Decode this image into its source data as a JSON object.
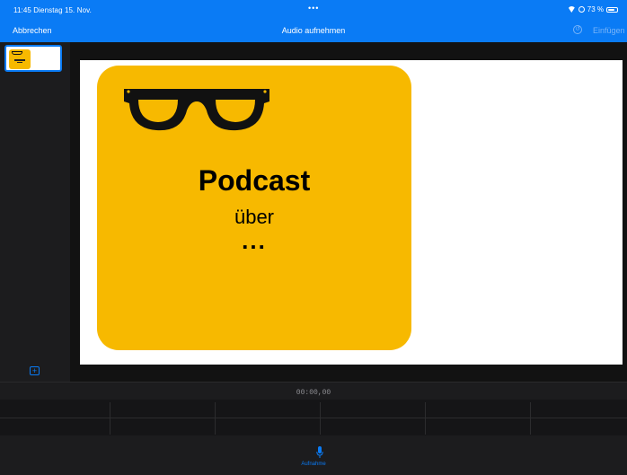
{
  "status": {
    "time": "11:45",
    "date": "Dienstag 15. Nov.",
    "battery": "73 %",
    "battery_level": 0.73
  },
  "nav": {
    "cancel_label": "Abbrechen",
    "title": "Audio aufnehmen",
    "paste_label": "Einfügen"
  },
  "slide": {
    "line1": "Podcast",
    "line2": "über",
    "line3": "..."
  },
  "timeline": {
    "timecode": "00:00,00",
    "record_label": "Aufnahme"
  },
  "colors": {
    "accent": "#0a7bf5",
    "card": "#f7b900"
  },
  "icons": [
    "wifi-icon",
    "rotation-lock-icon",
    "battery-icon",
    "undo-icon",
    "add-slide-icon",
    "glasses-icon",
    "microphone-icon"
  ]
}
